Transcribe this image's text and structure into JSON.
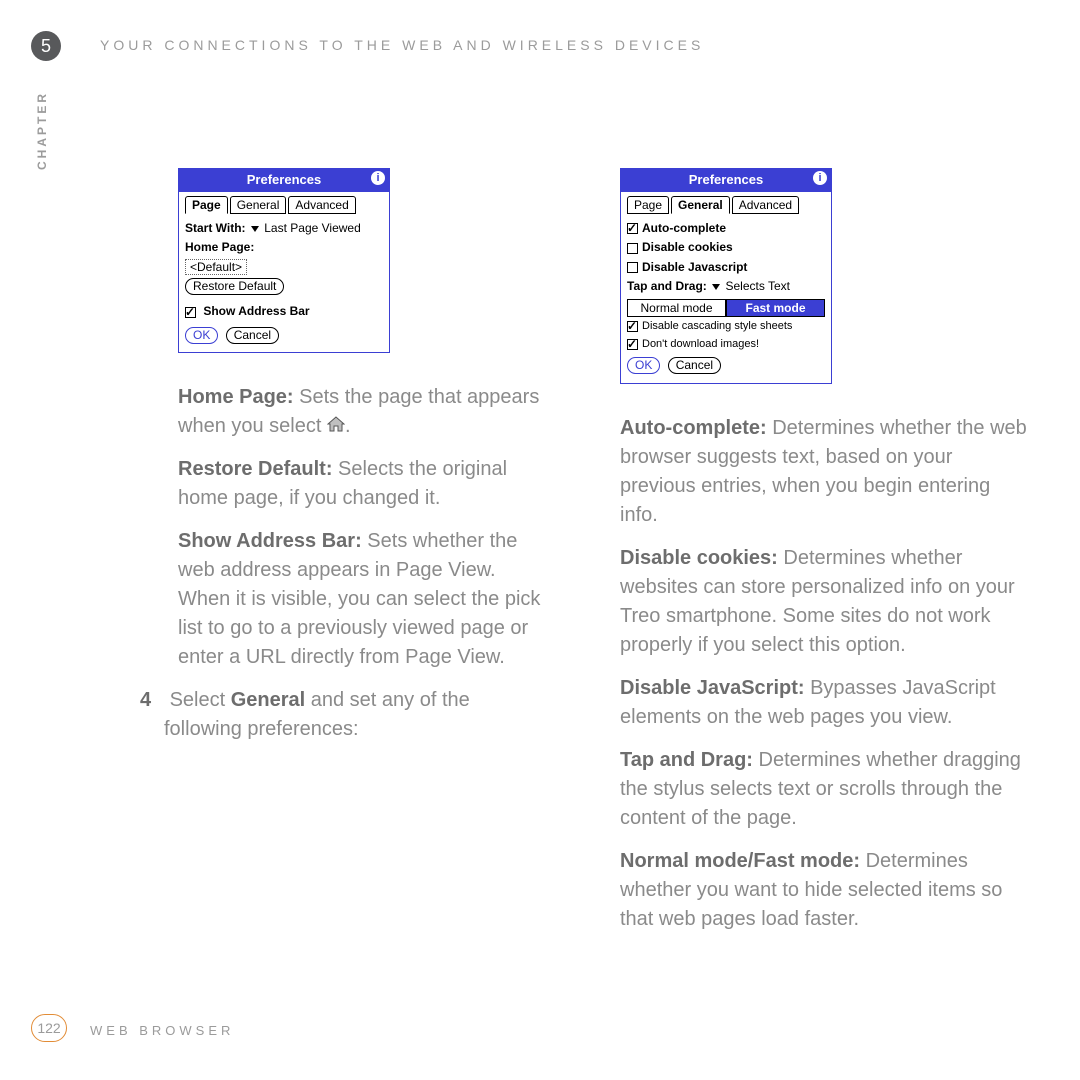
{
  "header": {
    "chapter_num": "5",
    "running_head": "YOUR CONNECTIONS TO THE WEB AND WIRELESS DEVICES",
    "chapter_word": "CHAPTER"
  },
  "footer": {
    "page_num": "122",
    "section": "WEB BROWSER"
  },
  "left_dialog": {
    "title": "Preferences",
    "tabs": {
      "page": "Page",
      "general": "General",
      "advanced": "Advanced",
      "active": "page"
    },
    "start_with_label": "Start With:",
    "start_with_value": "Last Page Viewed",
    "home_page_label": "Home Page:",
    "home_page_value": "<Default>",
    "restore_default_btn": "Restore Default",
    "show_address_bar": "Show Address Bar",
    "ok": "OK",
    "cancel": "Cancel"
  },
  "right_dialog": {
    "title": "Preferences",
    "tabs": {
      "page": "Page",
      "general": "General",
      "advanced": "Advanced",
      "active": "general"
    },
    "auto_complete": "Auto-complete",
    "disable_cookies": "Disable cookies",
    "disable_js": "Disable Javascript",
    "tap_drag_label": "Tap and Drag:",
    "tap_drag_value": "Selects Text",
    "normal_mode": "Normal mode",
    "fast_mode": "Fast mode",
    "disable_css": "Disable cascading style sheets",
    "no_images": "Don't download images!",
    "ok": "OK",
    "cancel": "Cancel"
  },
  "left_text": {
    "p1_b": "Home Page:",
    "p1": " Sets the page that appears when you select ",
    "p1_end": ".",
    "p2_b": "Restore Default:",
    "p2": " Selects the original home page, if you changed it.",
    "p3_b": "Show Address Bar:",
    "p3": " Sets whether the web address appears in Page View. When it is visible, you can select the pick list to go to a previously viewed page or enter a URL directly from Page View.",
    "step_num": "4",
    "step_a": "Select ",
    "step_b": "General",
    "step_c": " and set any of the following preferences:"
  },
  "right_text": {
    "p1_b": "Auto-complete:",
    "p1": " Determines whether the web browser suggests text, based on your previous entries, when you begin entering info.",
    "p2_b": "Disable cookies:",
    "p2": " Determines whether websites can store personalized info on your Treo smartphone. Some sites do not work properly if you select this option.",
    "p3_b": "Disable JavaScript:",
    "p3": " Bypasses JavaScript elements on the web pages you view.",
    "p4_b": "Tap and Drag:",
    "p4": " Determines whether dragging the stylus selects text or scrolls through the content of the page.",
    "p5_b": "Normal mode/Fast mode:",
    "p5": " Determines whether you want to hide selected items so that web pages load faster."
  }
}
